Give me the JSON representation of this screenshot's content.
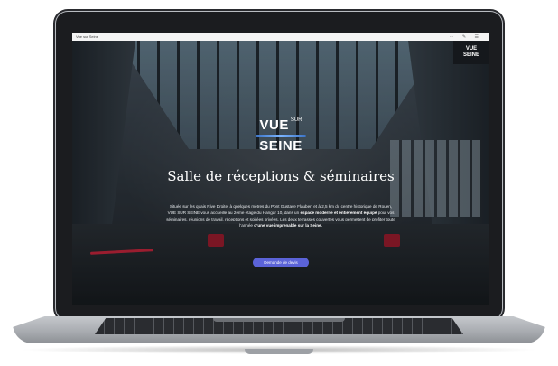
{
  "browser": {
    "tab_title": "Vue sur Seine",
    "icons": "⋯ ✎ ☰"
  },
  "corner_logo": {
    "line1": "VUE",
    "line2": "SEINE"
  },
  "hero_logo": {
    "vue": "VUE",
    "sur": "SUR",
    "seine": "SEINE"
  },
  "hero": {
    "title": "Salle de réceptions & séminaires",
    "paragraph_1": "Située sur les quais Rive Droite, à quelques mètres du Pont Gustave Flaubert et à 2,5 km du centre historique de Rouen,",
    "paragraph_2": "VUE SUR SEINE vous accueille au 2ème étage du Hangar 10, dans un",
    "paragraph_2_bold": "espace moderne et entièrement équipé",
    "paragraph_2_end": "pour vos",
    "paragraph_3": "séminaires, réunions de travail, réceptions et soirées privées. Les deux terrasses couvertes vous permettent de profiter toute",
    "paragraph_4": "l’année",
    "paragraph_4_bold": "d’une vue imprenable sur la Seine.",
    "cta_label": "Demande de devis"
  },
  "colors": {
    "cta": "#5b63d8",
    "accent_red": "#d2233b",
    "screen_bg": "#1a1f25"
  }
}
